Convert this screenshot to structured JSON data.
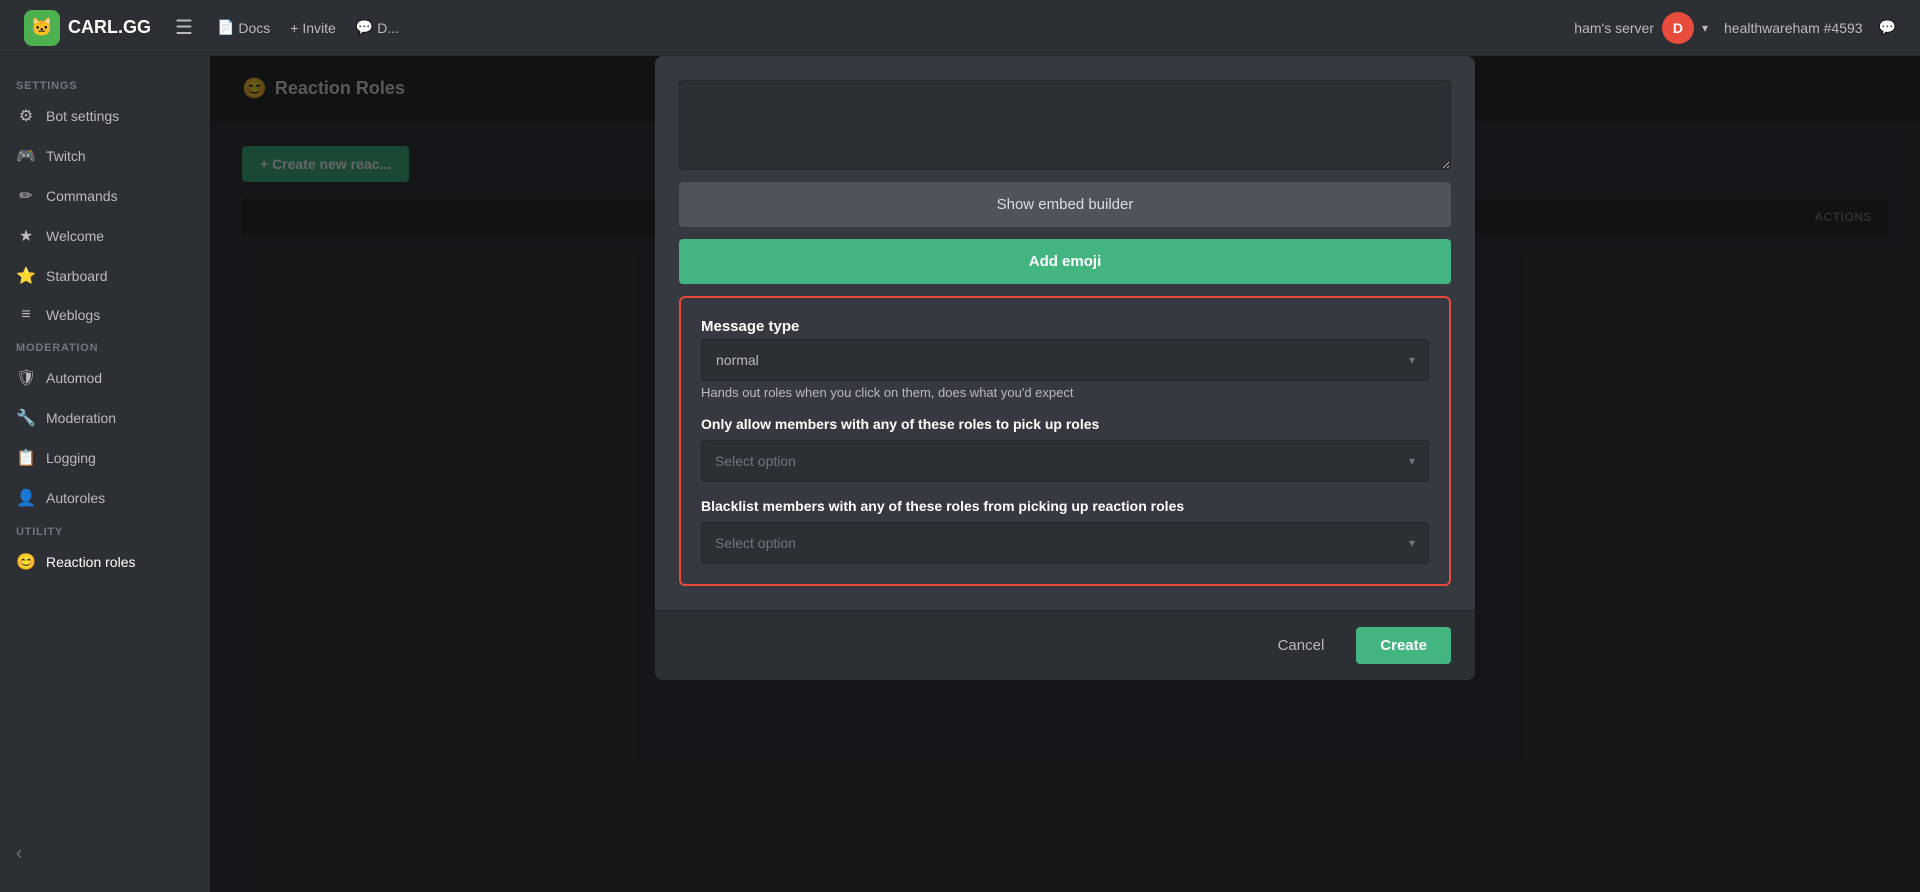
{
  "topnav": {
    "logo_text": "CARL.GG",
    "logo_emoji": "🐱",
    "menu_icon": "☰",
    "links": [
      {
        "label": "Docs",
        "icon": "📄"
      },
      {
        "label": "+ Invite",
        "icon": ""
      },
      {
        "label": "D...",
        "icon": "💬"
      }
    ],
    "server_name": "ham's server",
    "username": "healthwareham #4593",
    "chevron": "▾"
  },
  "sidebar": {
    "settings_label": "SETTINGS",
    "moderation_label": "MODERATION",
    "utility_label": "UTILITY",
    "items_settings": [
      {
        "label": "Bot settings",
        "icon": "⚙"
      },
      {
        "label": "Twitch",
        "icon": "🎮"
      },
      {
        "label": "Commands",
        "icon": "✏"
      },
      {
        "label": "Welcome",
        "icon": "★"
      },
      {
        "label": "Starboard",
        "icon": "⭐"
      },
      {
        "label": "Weblogs",
        "icon": "≡"
      }
    ],
    "items_moderation": [
      {
        "label": "Automod",
        "icon": "🛡"
      },
      {
        "label": "Moderation",
        "icon": "🔧"
      },
      {
        "label": "Logging",
        "icon": "📋"
      },
      {
        "label": "Autoroles",
        "icon": "👤"
      }
    ],
    "items_utility": [
      {
        "label": "Reaction roles",
        "icon": "😊"
      }
    ],
    "collapse_icon": "‹"
  },
  "page": {
    "header_icon": "😊",
    "header_title": "Reaction Roles",
    "create_button": "+ Create new reac...",
    "table_col_actions": "Actions"
  },
  "modal": {
    "embed_builder_label": "Show embed builder",
    "add_emoji_label": "Add emoji",
    "message_type_section": {
      "title": "Message type",
      "select_value": "normal",
      "description": "Hands out roles when you click on them, does what you'd expect"
    },
    "allow_roles_section": {
      "label": "Only allow members with any of these roles to pick up roles",
      "placeholder": "Select option"
    },
    "blacklist_roles_section": {
      "label": "Blacklist members with any of these roles from picking up reaction roles",
      "placeholder": "Select option"
    },
    "cancel_label": "Cancel",
    "create_label": "Create"
  }
}
